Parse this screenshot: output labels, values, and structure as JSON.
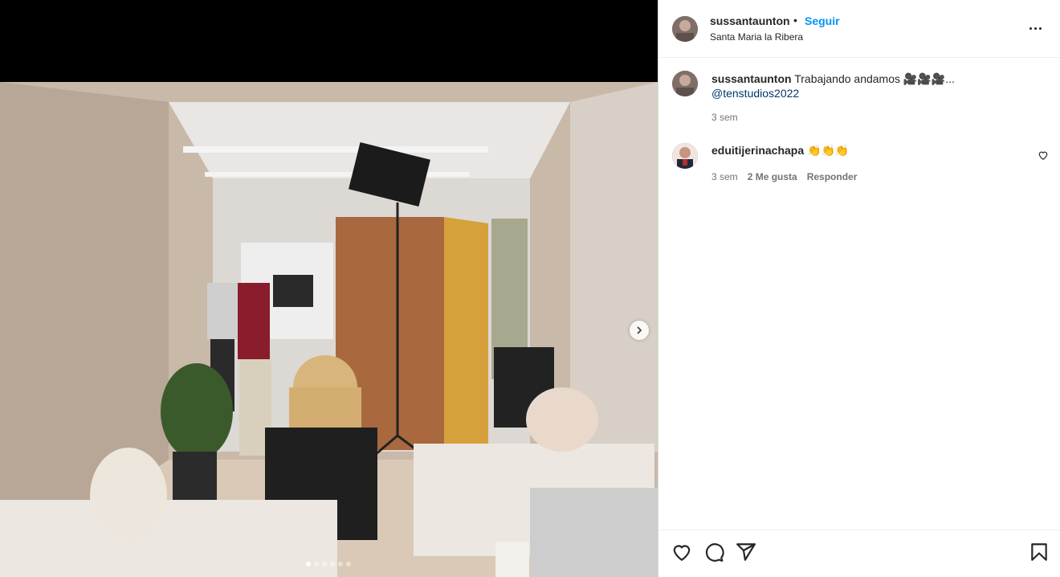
{
  "post": {
    "username": "sussantaunton",
    "separator": "•",
    "follow_label": "Seguir",
    "location": "Santa Maria la Ribera"
  },
  "caption": {
    "username": "sussantaunton",
    "text": "Trabajando andamos 🎥🎥🎥...",
    "mention": "@tenstudios2022",
    "time": "3 sem"
  },
  "comment": {
    "username": "eduitijerinachapa",
    "text": "👏👏👏",
    "time": "3 sem",
    "likes": "2 Me gusta",
    "reply": "Responder"
  },
  "carousel": {
    "total": 6,
    "active": 1
  },
  "icons": [
    "more-options-icon",
    "heart-icon",
    "comment-icon",
    "share-icon",
    "bookmark-icon",
    "chevron-right-icon"
  ],
  "colors": {
    "link": "#0095f6",
    "mention": "#00376b",
    "muted": "#737373"
  }
}
